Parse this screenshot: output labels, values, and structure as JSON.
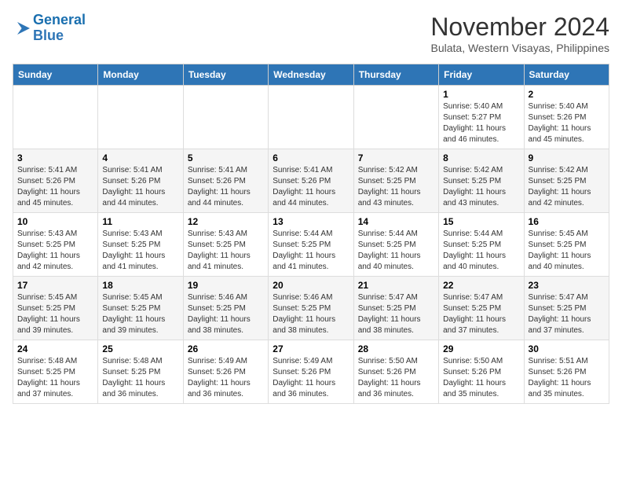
{
  "logo": {
    "line1": "General",
    "line2": "Blue"
  },
  "title": "November 2024",
  "location": "Bulata, Western Visayas, Philippines",
  "weekdays": [
    "Sunday",
    "Monday",
    "Tuesday",
    "Wednesday",
    "Thursday",
    "Friday",
    "Saturday"
  ],
  "weeks": [
    [
      {
        "day": "",
        "info": ""
      },
      {
        "day": "",
        "info": ""
      },
      {
        "day": "",
        "info": ""
      },
      {
        "day": "",
        "info": ""
      },
      {
        "day": "",
        "info": ""
      },
      {
        "day": "1",
        "info": "Sunrise: 5:40 AM\nSunset: 5:27 PM\nDaylight: 11 hours and 46 minutes."
      },
      {
        "day": "2",
        "info": "Sunrise: 5:40 AM\nSunset: 5:26 PM\nDaylight: 11 hours and 45 minutes."
      }
    ],
    [
      {
        "day": "3",
        "info": "Sunrise: 5:41 AM\nSunset: 5:26 PM\nDaylight: 11 hours and 45 minutes."
      },
      {
        "day": "4",
        "info": "Sunrise: 5:41 AM\nSunset: 5:26 PM\nDaylight: 11 hours and 44 minutes."
      },
      {
        "day": "5",
        "info": "Sunrise: 5:41 AM\nSunset: 5:26 PM\nDaylight: 11 hours and 44 minutes."
      },
      {
        "day": "6",
        "info": "Sunrise: 5:41 AM\nSunset: 5:26 PM\nDaylight: 11 hours and 44 minutes."
      },
      {
        "day": "7",
        "info": "Sunrise: 5:42 AM\nSunset: 5:25 PM\nDaylight: 11 hours and 43 minutes."
      },
      {
        "day": "8",
        "info": "Sunrise: 5:42 AM\nSunset: 5:25 PM\nDaylight: 11 hours and 43 minutes."
      },
      {
        "day": "9",
        "info": "Sunrise: 5:42 AM\nSunset: 5:25 PM\nDaylight: 11 hours and 42 minutes."
      }
    ],
    [
      {
        "day": "10",
        "info": "Sunrise: 5:43 AM\nSunset: 5:25 PM\nDaylight: 11 hours and 42 minutes."
      },
      {
        "day": "11",
        "info": "Sunrise: 5:43 AM\nSunset: 5:25 PM\nDaylight: 11 hours and 41 minutes."
      },
      {
        "day": "12",
        "info": "Sunrise: 5:43 AM\nSunset: 5:25 PM\nDaylight: 11 hours and 41 minutes."
      },
      {
        "day": "13",
        "info": "Sunrise: 5:44 AM\nSunset: 5:25 PM\nDaylight: 11 hours and 41 minutes."
      },
      {
        "day": "14",
        "info": "Sunrise: 5:44 AM\nSunset: 5:25 PM\nDaylight: 11 hours and 40 minutes."
      },
      {
        "day": "15",
        "info": "Sunrise: 5:44 AM\nSunset: 5:25 PM\nDaylight: 11 hours and 40 minutes."
      },
      {
        "day": "16",
        "info": "Sunrise: 5:45 AM\nSunset: 5:25 PM\nDaylight: 11 hours and 40 minutes."
      }
    ],
    [
      {
        "day": "17",
        "info": "Sunrise: 5:45 AM\nSunset: 5:25 PM\nDaylight: 11 hours and 39 minutes."
      },
      {
        "day": "18",
        "info": "Sunrise: 5:45 AM\nSunset: 5:25 PM\nDaylight: 11 hours and 39 minutes."
      },
      {
        "day": "19",
        "info": "Sunrise: 5:46 AM\nSunset: 5:25 PM\nDaylight: 11 hours and 38 minutes."
      },
      {
        "day": "20",
        "info": "Sunrise: 5:46 AM\nSunset: 5:25 PM\nDaylight: 11 hours and 38 minutes."
      },
      {
        "day": "21",
        "info": "Sunrise: 5:47 AM\nSunset: 5:25 PM\nDaylight: 11 hours and 38 minutes."
      },
      {
        "day": "22",
        "info": "Sunrise: 5:47 AM\nSunset: 5:25 PM\nDaylight: 11 hours and 37 minutes."
      },
      {
        "day": "23",
        "info": "Sunrise: 5:47 AM\nSunset: 5:25 PM\nDaylight: 11 hours and 37 minutes."
      }
    ],
    [
      {
        "day": "24",
        "info": "Sunrise: 5:48 AM\nSunset: 5:25 PM\nDaylight: 11 hours and 37 minutes."
      },
      {
        "day": "25",
        "info": "Sunrise: 5:48 AM\nSunset: 5:25 PM\nDaylight: 11 hours and 36 minutes."
      },
      {
        "day": "26",
        "info": "Sunrise: 5:49 AM\nSunset: 5:26 PM\nDaylight: 11 hours and 36 minutes."
      },
      {
        "day": "27",
        "info": "Sunrise: 5:49 AM\nSunset: 5:26 PM\nDaylight: 11 hours and 36 minutes."
      },
      {
        "day": "28",
        "info": "Sunrise: 5:50 AM\nSunset: 5:26 PM\nDaylight: 11 hours and 36 minutes."
      },
      {
        "day": "29",
        "info": "Sunrise: 5:50 AM\nSunset: 5:26 PM\nDaylight: 11 hours and 35 minutes."
      },
      {
        "day": "30",
        "info": "Sunrise: 5:51 AM\nSunset: 5:26 PM\nDaylight: 11 hours and 35 minutes."
      }
    ]
  ]
}
